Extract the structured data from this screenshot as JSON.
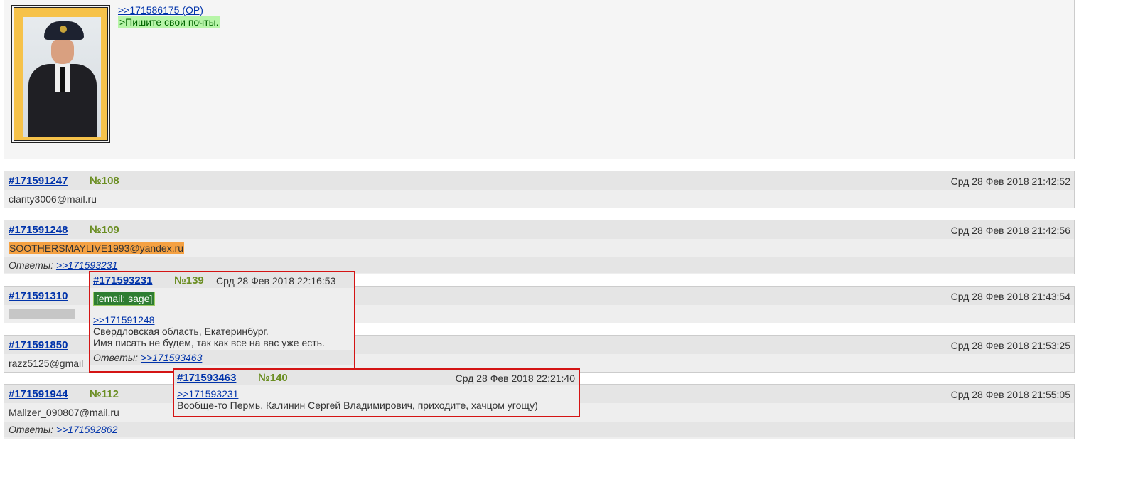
{
  "op_post": {
    "reply_link": ">>171586175 (OP)",
    "quote": ">Пишите свои почты."
  },
  "posts": [
    {
      "id": "#171591247",
      "num": "№108",
      "date": "Срд 28 Фев 2018 21:42:52",
      "body": "clarity3006@mail.ru"
    },
    {
      "id": "#171591248",
      "num": "№109",
      "date": "Срд 28 Фев 2018 21:42:56",
      "body": "SOOTHERSMAYLIVE1993@yandex.ru",
      "replies_label": "Ответы:",
      "replies_link": ">>171593231"
    },
    {
      "id": "#171591310",
      "num": "",
      "date": "Срд 28 Фев 2018 21:43:54",
      "body": ""
    },
    {
      "id": "#171591850",
      "num": "",
      "date": "Срд 28 Фев 2018 21:53:25",
      "body": "razz5125@gmail"
    },
    {
      "id": "#171591944",
      "num": "№112",
      "date": "Срд 28 Фев 2018 21:55:05",
      "body": "Mallzer_090807@mail.ru",
      "replies_label": "Ответы:",
      "replies_link": ">>171592862"
    }
  ],
  "popup1": {
    "id": "#171593231",
    "num": "№139",
    "date": "Срд 28 Фев 2018 22:16:53",
    "email": "[email: sage]",
    "reply_link": ">>171591248",
    "line1": "Свердловская область, Екатеринбург.",
    "line2": "Имя писать не будем, так как все на вас уже есть.",
    "replies_label": "Ответы:",
    "replies_link": ">>171593463"
  },
  "popup2": {
    "id": "#171593463",
    "num": "№140",
    "date": "Срд 28 Фев 2018 22:21:40",
    "reply_link": ">>171593231",
    "text": "Вообще-то Пермь, Калинин Сергей Владимирович, приходите, хачцом угощу)"
  }
}
